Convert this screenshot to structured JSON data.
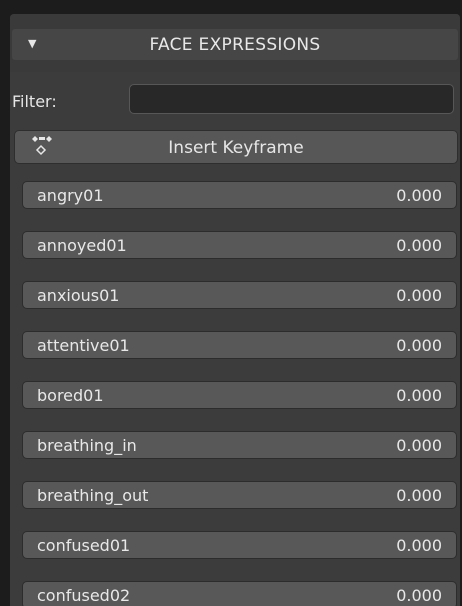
{
  "panel": {
    "collapse_glyph": "▼",
    "title": "FACE EXPRESSIONS"
  },
  "filter": {
    "label": "Filter:",
    "value": "",
    "placeholder": ""
  },
  "keyframe": {
    "label": "Insert Keyframe",
    "icon": "keyframe-icon"
  },
  "expressions": [
    {
      "name": "angry01",
      "value": "0.000"
    },
    {
      "name": "annoyed01",
      "value": "0.000"
    },
    {
      "name": "anxious01",
      "value": "0.000"
    },
    {
      "name": "attentive01",
      "value": "0.000"
    },
    {
      "name": "bored01",
      "value": "0.000"
    },
    {
      "name": "breathing_in",
      "value": "0.000"
    },
    {
      "name": "breathing_out",
      "value": "0.000"
    },
    {
      "name": "confused01",
      "value": "0.000"
    },
    {
      "name": "confused02",
      "value": "0.000"
    }
  ]
}
